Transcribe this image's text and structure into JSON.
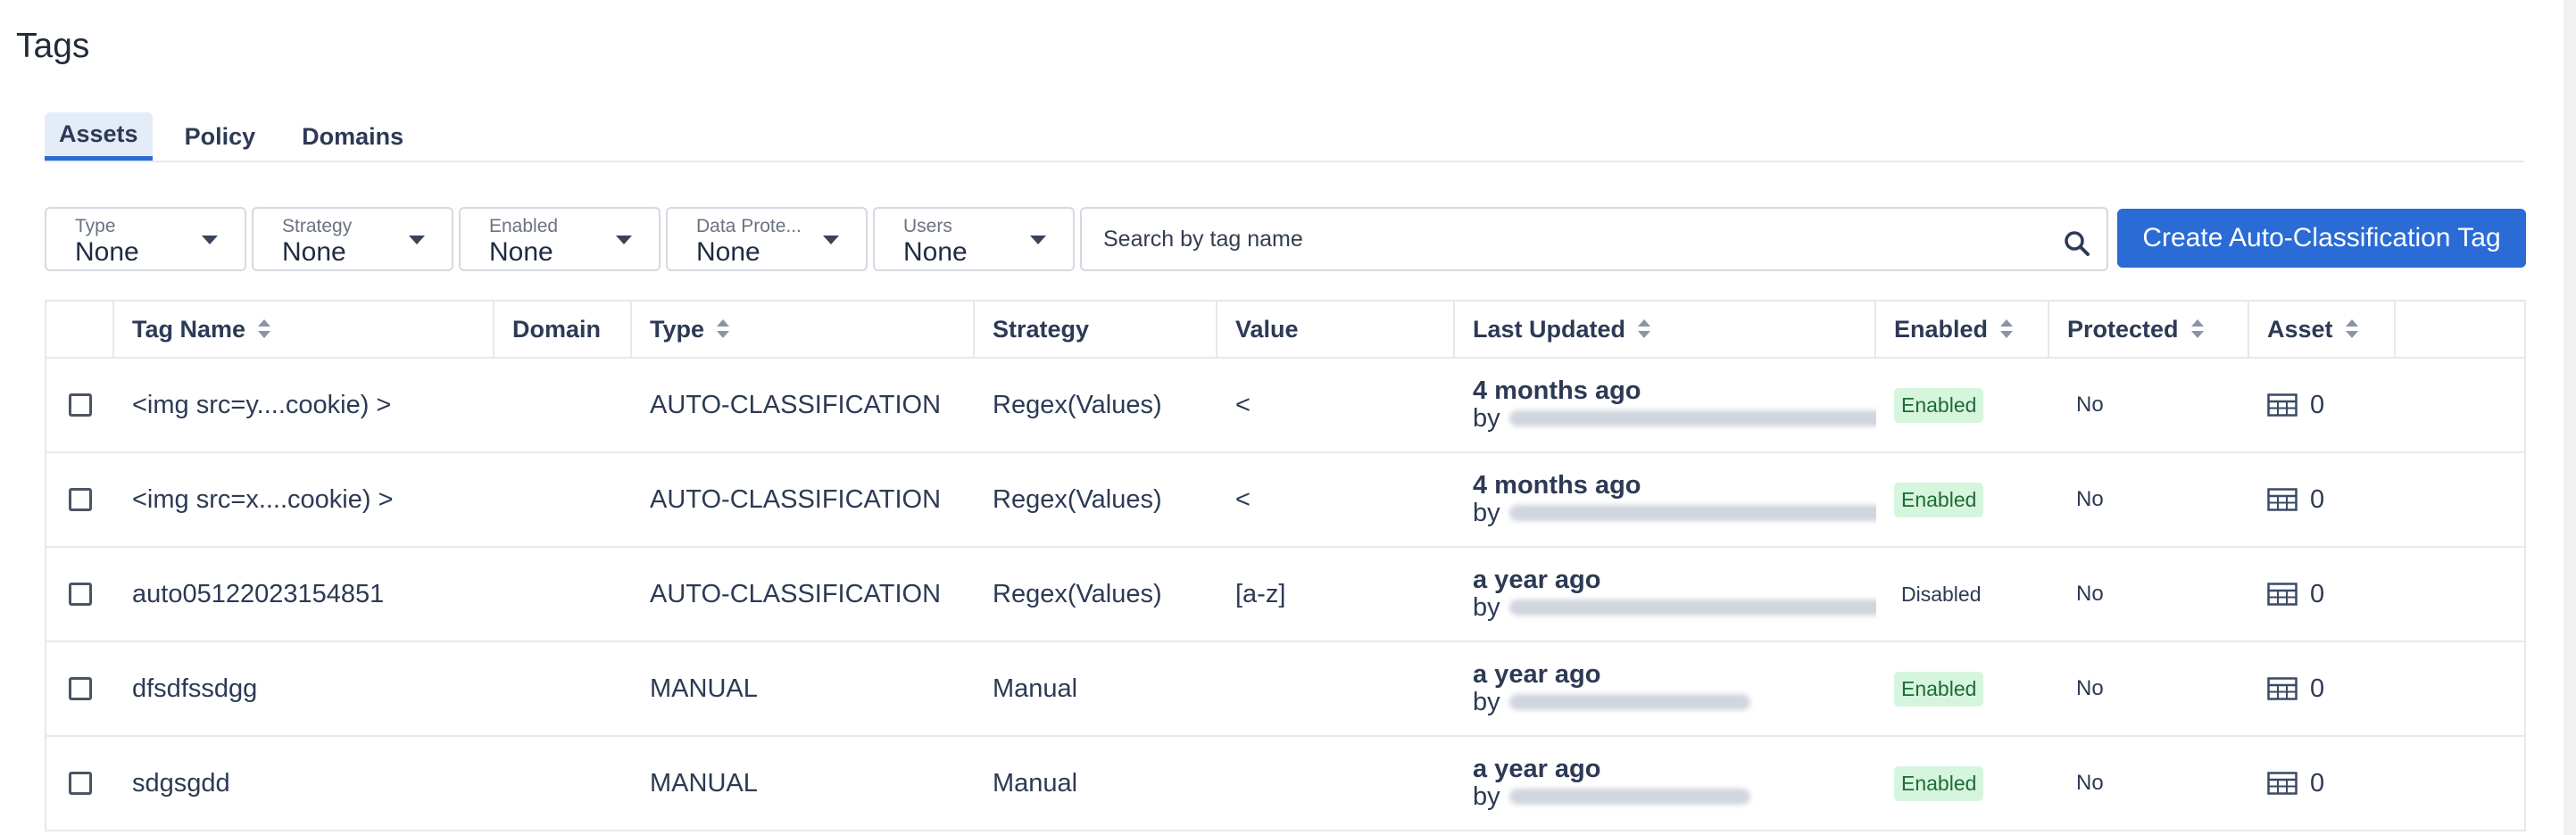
{
  "page": {
    "title": "Tags"
  },
  "tabs": [
    {
      "label": "Assets",
      "active": true
    },
    {
      "label": "Policy",
      "active": false
    },
    {
      "label": "Domains",
      "active": false
    }
  ],
  "filters": [
    {
      "label": "Type",
      "value": "None"
    },
    {
      "label": "Strategy",
      "value": "None"
    },
    {
      "label": "Enabled",
      "value": "None"
    },
    {
      "label": "Data Prote...",
      "value": "None"
    },
    {
      "label": "Users",
      "value": "None"
    }
  ],
  "search": {
    "placeholder": "Search by tag name"
  },
  "create_button": {
    "label": "Create Auto-Classification Tag"
  },
  "table": {
    "headers": {
      "name": "Tag Name",
      "domain": "Domain",
      "type": "Type",
      "strategy": "Strategy",
      "value": "Value",
      "updated": "Last Updated",
      "enabled": "Enabled",
      "protected": "Protected",
      "asset": "Asset"
    },
    "rows": [
      {
        "name": "<img src=y....cookie) >",
        "domain": "",
        "type": "AUTO-CLASSIFICATION",
        "strategy": "Regex(Values)",
        "value": "<",
        "updated": "4 months ago",
        "by": "by",
        "enabled": "Enabled",
        "enabled_on": true,
        "protected": "No",
        "asset": "0"
      },
      {
        "name": "<img src=x....cookie) >",
        "domain": "",
        "type": "AUTO-CLASSIFICATION",
        "strategy": "Regex(Values)",
        "value": "<",
        "updated": "4 months ago",
        "by": "by",
        "enabled": "Enabled",
        "enabled_on": true,
        "protected": "No",
        "asset": "0"
      },
      {
        "name": "auto05122023154851",
        "domain": "",
        "type": "AUTO-CLASSIFICATION",
        "strategy": "Regex(Values)",
        "value": "[a-z]",
        "updated": "a year ago",
        "by": "by",
        "enabled": "Disabled",
        "enabled_on": false,
        "protected": "No",
        "asset": "0"
      },
      {
        "name": "dfsdfssdgg",
        "domain": "",
        "type": "MANUAL",
        "strategy": "Manual",
        "value": "",
        "updated": "a year ago",
        "by": "by",
        "enabled": "Enabled",
        "enabled_on": true,
        "protected": "No",
        "asset": "0"
      },
      {
        "name": "sdgsgdd",
        "domain": "",
        "type": "MANUAL",
        "strategy": "Manual",
        "value": "",
        "updated": "a year ago",
        "by": "by",
        "enabled": "Enabled",
        "enabled_on": true,
        "protected": "No",
        "asset": "0"
      }
    ]
  },
  "colors": {
    "primary": "#2a6bd6",
    "enabled_bg": "#d6f5dd",
    "enabled_text": "#1f6b35",
    "border": "#e6e8ec"
  },
  "icons": {
    "sort": "sort-icon",
    "search": "search-icon",
    "asset": "table-icon",
    "dropdown": "caret-down-icon"
  }
}
